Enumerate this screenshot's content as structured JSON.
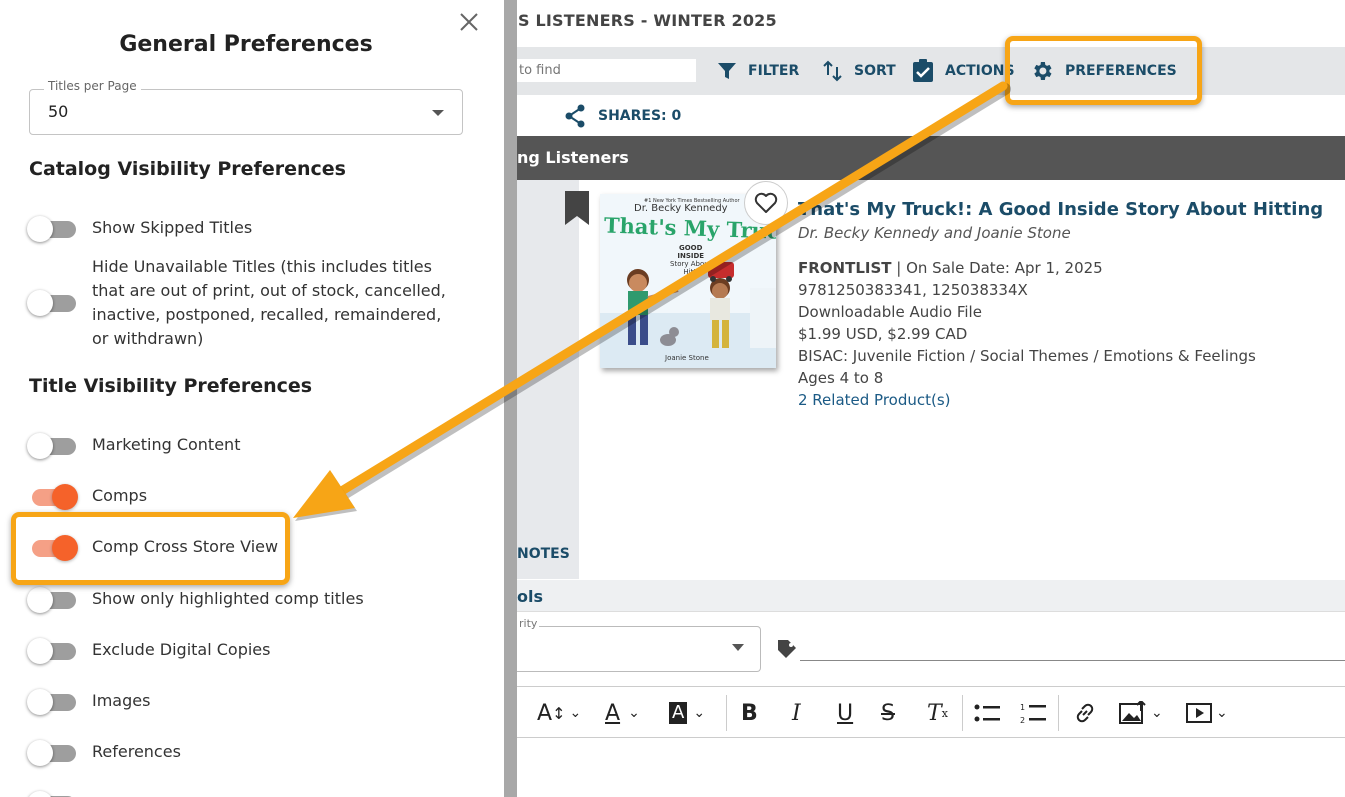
{
  "app": {
    "catalog_title": "S LISTENERS - WINTER 2025",
    "search_placeholder": "to find",
    "toolbar": {
      "filter": "FILTER",
      "sort": "SORT",
      "actions": "ACTIONS",
      "preferences": "PREFERENCES"
    },
    "shares": "SHARES: 0",
    "section_title": "ng Listeners",
    "notes_tab": "NOTES",
    "tools_title": "ols",
    "priority_label": "rity",
    "book": {
      "cover": {
        "tagline": "#1 New York Times Bestselling Author",
        "author": "Dr. Becky Kennedy",
        "title": "That's My Truck!",
        "subtitle_1": "GOOD",
        "subtitle_2": "INSIDE",
        "subtitle_3": "Story About",
        "subtitle_4": "Hitti",
        "illustrator": "Joanie Stone"
      },
      "title": "That's My Truck!: A Good Inside Story About Hitting",
      "authors": "Dr. Becky Kennedy and Joanie Stone",
      "list": "FRONTLIST",
      "sale_info": " | On Sale Date: Apr 1, 2025",
      "isbns": "9781250383341, 125038334X",
      "format": "Downloadable Audio File",
      "price": "$1.99 USD, $2.99 CAD",
      "bisac": "BISAC: Juvenile Fiction / Social Themes / Emotions & Feelings",
      "ages": "Ages 4 to 8",
      "related": "2 Related Product(s)"
    }
  },
  "panel": {
    "title": "General Preferences",
    "titles_per_page_label": "Titles per Page",
    "titles_per_page_value": "50",
    "catalog_heading": "Catalog Visibility Preferences",
    "title_heading": "Title Visibility Preferences",
    "catalog_prefs": [
      {
        "label": "Show Skipped Titles",
        "on": false
      },
      {
        "label": "Hide Unavailable Titles (this includes titles that are out of print, out of stock, cancelled, inactive, postponed, recalled, remaindered, or withdrawn)",
        "on": false
      }
    ],
    "title_prefs": [
      {
        "label": "Marketing Content",
        "on": false
      },
      {
        "label": "Comps",
        "on": true
      },
      {
        "label": "Comp Cross Store View",
        "on": true
      },
      {
        "label": "Show only highlighted comp titles",
        "on": false
      },
      {
        "label": "Exclude Digital Copies",
        "on": false
      },
      {
        "label": "Images",
        "on": false
      },
      {
        "label": "References",
        "on": false
      }
    ]
  },
  "colors": {
    "accent_orange": "#f7a516",
    "toggle_on": "#f5622a",
    "link_blue": "#1b4c68"
  }
}
